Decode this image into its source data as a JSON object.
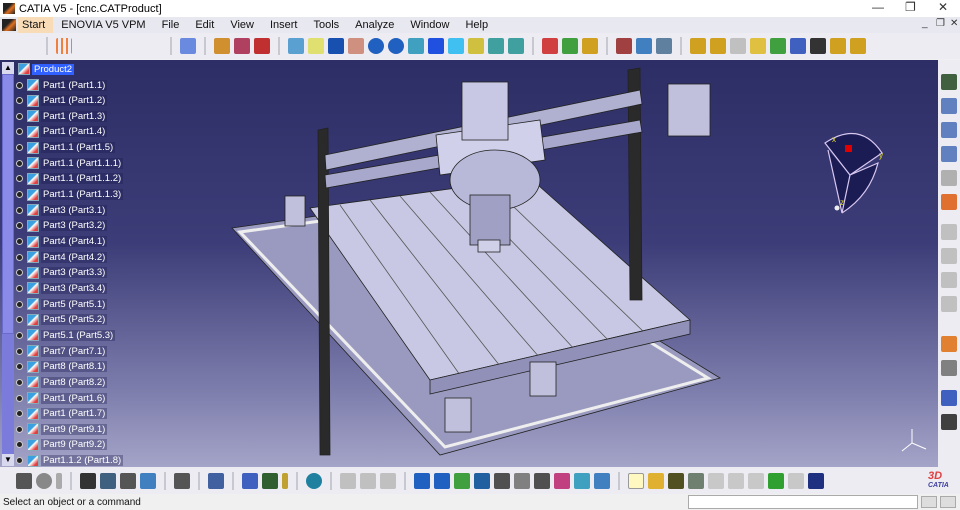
{
  "window": {
    "title": "CATIA V5 - [cnc.CATProduct]",
    "controls": [
      "minimize",
      "restore",
      "close"
    ]
  },
  "menu": {
    "items": [
      "Start",
      "ENOVIA V5 VPM",
      "File",
      "Edit",
      "View",
      "Insert",
      "Tools",
      "Analyze",
      "Window",
      "Help"
    ]
  },
  "tree": {
    "root": "Product2",
    "items": [
      "Part1 (Part1.1)",
      "Part1 (Part1.2)",
      "Part1 (Part1.3)",
      "Part1 (Part1.4)",
      "Part1.1 (Part1.5)",
      "Part1.1 (Part1.1.1)",
      "Part1.1 (Part1.1.2)",
      "Part1.1 (Part1.1.3)",
      "Part3 (Part3.1)",
      "Part3 (Part3.2)",
      "Part4 (Part4.1)",
      "Part4 (Part4.2)",
      "Part3 (Part3.3)",
      "Part3 (Part3.4)",
      "Part5 (Part5.1)",
      "Part5 (Part5.2)",
      "Part5.1 (Part5.3)",
      "Part7 (Part7.1)",
      "Part8 (Part8.1)",
      "Part8 (Part8.2)",
      "Part1 (Part1.6)",
      "Part1 (Part1.7)",
      "Part9 (Part9.1)",
      "Part9 (Part9.2)",
      "Part1.1.2 (Part1.8)"
    ]
  },
  "compass": {
    "x": "x",
    "y": "y",
    "z": "z"
  },
  "brand": {
    "logo_text": "CATIA"
  },
  "status": {
    "message": "Select an object or a command",
    "command_input": ""
  },
  "colors": {
    "viewport_top": "#2e2e66",
    "viewport_bottom": "#a4a4c8",
    "selection": "#3060ff",
    "compass_handle": "#e00000"
  }
}
